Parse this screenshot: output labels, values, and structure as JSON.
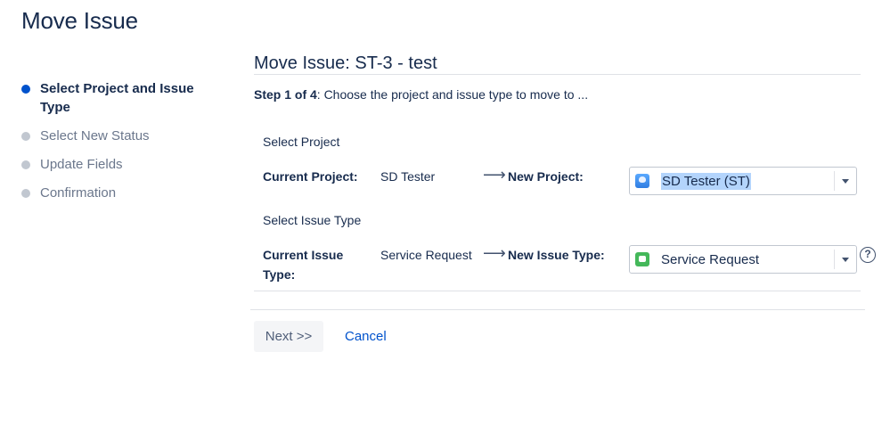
{
  "page": {
    "title": "Move Issue"
  },
  "steps": [
    {
      "label": "Select Project and Issue Type",
      "active": true
    },
    {
      "label": "Select New Status",
      "active": false
    },
    {
      "label": "Update Fields",
      "active": false
    },
    {
      "label": "Confirmation",
      "active": false
    }
  ],
  "main": {
    "title": "Move Issue: ST-3 - test",
    "step_prefix": "Step 1 of 4",
    "step_text": ": Choose the project and issue type to move to ..."
  },
  "project": {
    "section_label": "Select Project",
    "current_label": "Current Project",
    "current_value": "SD Tester",
    "new_label": "New Project",
    "selected": "SD Tester (ST)",
    "icon": "project-avatar-icon"
  },
  "issue_type": {
    "section_label": "Select Issue Type",
    "current_label": "Current Issue Type",
    "current_value": "Service Request",
    "new_label": "New Issue Type",
    "selected": "Service Request",
    "icon": "service-request-icon"
  },
  "glyphs": {
    "arrow": "⟶",
    "colon": ":",
    "help": "?"
  },
  "actions": {
    "next": "Next >>",
    "cancel": "Cancel"
  },
  "colors": {
    "accent": "#0052cc",
    "selection_highlight": "#b3d4fc",
    "text": "#172b4d"
  }
}
